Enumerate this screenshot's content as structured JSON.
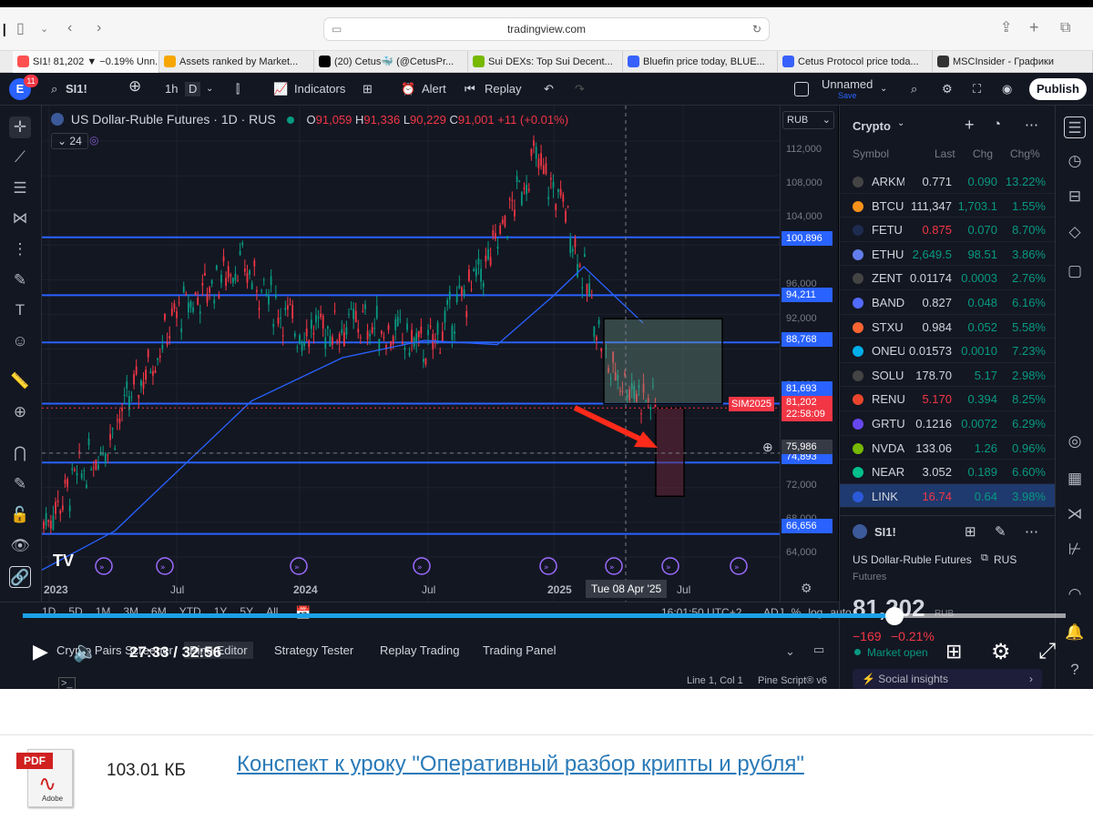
{
  "browser": {
    "url": "tradingview.com",
    "tabs": [
      {
        "title": "SI1! 81,202 ▼ −0.19% Unn...",
        "color": "#ff5050"
      },
      {
        "title": "Assets ranked by Market...",
        "color": "#f7a600"
      },
      {
        "title": "(20) Cetus🐳 (@CetusPr...",
        "color": "#000000"
      },
      {
        "title": "Sui DEXs: Top Sui Decent...",
        "color": "#76b900"
      },
      {
        "title": "Bluefin price today, BLUE...",
        "color": "#3861fb"
      },
      {
        "title": "Cetus Protocol price toda...",
        "color": "#3861fb"
      },
      {
        "title": "MSCInsider - Графики",
        "color": "#333333"
      }
    ]
  },
  "toolbar": {
    "avatar": "E",
    "notif_count": "11",
    "symbol": "SI1!",
    "interval": "1h",
    "interval_d": "D",
    "indicators": "Indicators",
    "alert": "Alert",
    "replay": "Replay",
    "layout_name": "Unnamed",
    "layout_status": "Save",
    "publish": "Publish"
  },
  "legend": {
    "title": "US Dollar-Ruble Futures · 1D · RUS",
    "o_label": "O",
    "o": "91,059",
    "h_label": "H",
    "h": "91,336",
    "l_label": "L",
    "l": "90,229",
    "c_label": "C",
    "c": "91,001",
    "change": "+11 (+0.01%)",
    "indicator_count": "24"
  },
  "yaxis": {
    "currency": "RUB",
    "ticks": [
      "112,000",
      "108,000",
      "104,000",
      "96,000",
      "92,000",
      "84,000",
      "72,000",
      "68,000",
      "64,000"
    ],
    "levels": [
      "100,896",
      "94,211",
      "88,768",
      "81,693",
      "74,893",
      "66,656"
    ],
    "current_price": "81,202",
    "countdown": "22:58:09",
    "crosshair": "75,986",
    "sim_label": "SIM2025"
  },
  "xaxis": {
    "labels": [
      "2023",
      "Jul",
      "2024",
      "Jul",
      "2025",
      "Jul"
    ],
    "crosshair_date": "Tue 08 Apr '25",
    "ranges": [
      "1D",
      "5D",
      "1M",
      "3M",
      "6M",
      "YTD",
      "1Y",
      "5Y",
      "All"
    ],
    "time": "16:01:50 UTC+2",
    "mode_labels": [
      "ADJ",
      "%",
      "log",
      "auto"
    ]
  },
  "watchlist": {
    "title": "Crypto",
    "headers": [
      "Symbol",
      "Last",
      "Chg",
      "Chg%"
    ],
    "rows": [
      {
        "sym": "ARKM",
        "last": "0.771",
        "chg": "0.090",
        "pct": "13.22%",
        "icon": "#444444",
        "lastcolor": "#d1d4dc"
      },
      {
        "sym": "BTCU",
        "last": "111,347",
        "chg": "1,703.1",
        "pct": "1.55%",
        "icon": "#f7931a",
        "lastcolor": "#d1d4dc"
      },
      {
        "sym": "FETU",
        "last": "0.875",
        "chg": "0.070",
        "pct": "8.70%",
        "icon": "#1d2b4f",
        "lastcolor": "#f23645"
      },
      {
        "sym": "ETHU",
        "last": "2,649.5",
        "chg": "98.51",
        "pct": "3.86%",
        "icon": "#627eea",
        "lastcolor": "#089981"
      },
      {
        "sym": "ZENT",
        "last": "0.01174",
        "chg": "0.0003",
        "pct": "2.76%",
        "icon": "#444444",
        "lastcolor": "#d1d4dc"
      },
      {
        "sym": "BAND",
        "last": "0.827",
        "chg": "0.048",
        "pct": "6.16%",
        "icon": "#516aff",
        "lastcolor": "#d1d4dc"
      },
      {
        "sym": "STXU",
        "last": "0.984",
        "chg": "0.052",
        "pct": "5.58%",
        "icon": "#fc6432",
        "lastcolor": "#d1d4dc"
      },
      {
        "sym": "ONEU",
        "last": "0.01573",
        "chg": "0.0010",
        "pct": "7.23%",
        "icon": "#00aee9",
        "lastcolor": "#d1d4dc"
      },
      {
        "sym": "SOLU",
        "last": "178.70",
        "chg": "5.17",
        "pct": "2.98%",
        "icon": "#444444",
        "lastcolor": "#d1d4dc"
      },
      {
        "sym": "RENU",
        "last": "5.170",
        "chg": "0.394",
        "pct": "8.25%",
        "icon": "#e8452c",
        "lastcolor": "#f23645"
      },
      {
        "sym": "GRTU",
        "last": "0.1216",
        "chg": "0.0072",
        "pct": "6.29%",
        "icon": "#6747ed",
        "lastcolor": "#d1d4dc"
      },
      {
        "sym": "NVDA",
        "last": "133.06",
        "chg": "1.26",
        "pct": "0.96%",
        "icon": "#76b900",
        "lastcolor": "#d1d4dc"
      },
      {
        "sym": "NEAR",
        "last": "3.052",
        "chg": "0.189",
        "pct": "6.60%",
        "icon": "#00c08b",
        "lastcolor": "#d1d4dc"
      },
      {
        "sym": "LINK",
        "last": "16.74",
        "chg": "0.64",
        "pct": "3.98%",
        "icon": "#2a5ada",
        "lastcolor": "#f23645"
      }
    ],
    "detail": {
      "symbol": "SI1!",
      "name": "US Dollar-Ruble Futures",
      "exchange": "RUS",
      "type": "Futures",
      "price": "81,202",
      "currency": "RUB",
      "change": "−169",
      "change_pct": "−0.21%",
      "market_status": "Market open",
      "social": "Social insights"
    }
  },
  "bottom_panel": {
    "tabs": [
      "Crypto Pairs Screener",
      "Pine Editor",
      "Strategy Tester",
      "Replay Trading",
      "Trading Panel"
    ],
    "status": "Line 1, Col 1",
    "pine_version": "Pine Script® v6"
  },
  "player": {
    "time": "27:33 / 32:56",
    "progress": 0.836
  },
  "attachment": {
    "file_label": "PDF",
    "file_brand": "Adobe",
    "size": "103.01 КБ",
    "link": "Конспект к уроку \"Оперативный разбор крипты и рубля\""
  },
  "chart_data": {
    "type": "line",
    "title": "US Dollar-Ruble Futures · 1D · RUS",
    "x": [
      "2023-01",
      "2023-04",
      "2023-07",
      "2023-10",
      "2024-01",
      "2024-04",
      "2024-07",
      "2024-10",
      "2024-12",
      "2025-01",
      "2025-03",
      "2025-04"
    ],
    "series": [
      {
        "values": [
          68000,
          78000,
          92000,
          98000,
          90000,
          91000,
          88000,
          98000,
          110000,
          104000,
          86000,
          81202
        ]
      }
    ],
    "ylim": [
      62000,
      114000
    ],
    "horizontal_levels": [
      100896,
      94211,
      88768,
      81693,
      74893,
      66656
    ]
  }
}
